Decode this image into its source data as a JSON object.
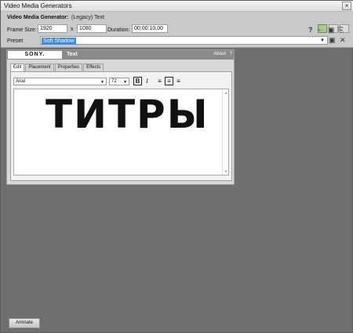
{
  "window": {
    "title": "Video Media Generators",
    "close_glyph": "×"
  },
  "header": {
    "generator_label": "Video Media Generator:",
    "generator_value": "(Legacy) Text",
    "frame_size_label": "Frame Size:",
    "width": "1920",
    "x_label": "x",
    "height": "1080",
    "duration_label": "Duration:",
    "duration": "00:00:10,00",
    "preset_label": "Preset",
    "preset_value": "Soft Shadow"
  },
  "icons": {
    "layout_icons": [
      "layout-grid-icon",
      "layout-list-icon",
      "layout-detail-icon"
    ],
    "toolbar": [
      "help-icon",
      "insert-clip-icon",
      "save-preset-icon",
      "properties-icon"
    ]
  },
  "toolbar_glyphs": {
    "help": "?",
    "save": "▣",
    "delete": "✕"
  },
  "plugin": {
    "brand": "SONY.",
    "name": "Text",
    "about": "About",
    "help": "?",
    "tabs": [
      "Edit",
      "Placement",
      "Properties",
      "Effects"
    ],
    "active_tab": "Edit",
    "font": "Arial",
    "size": "72",
    "bold": "B",
    "italic": "I",
    "text": "ТИТРЫ"
  },
  "footer": {
    "animate_label": "Animate"
  },
  "colors": {
    "selection": "#3b8be0",
    "background": "#6f6f6f"
  }
}
